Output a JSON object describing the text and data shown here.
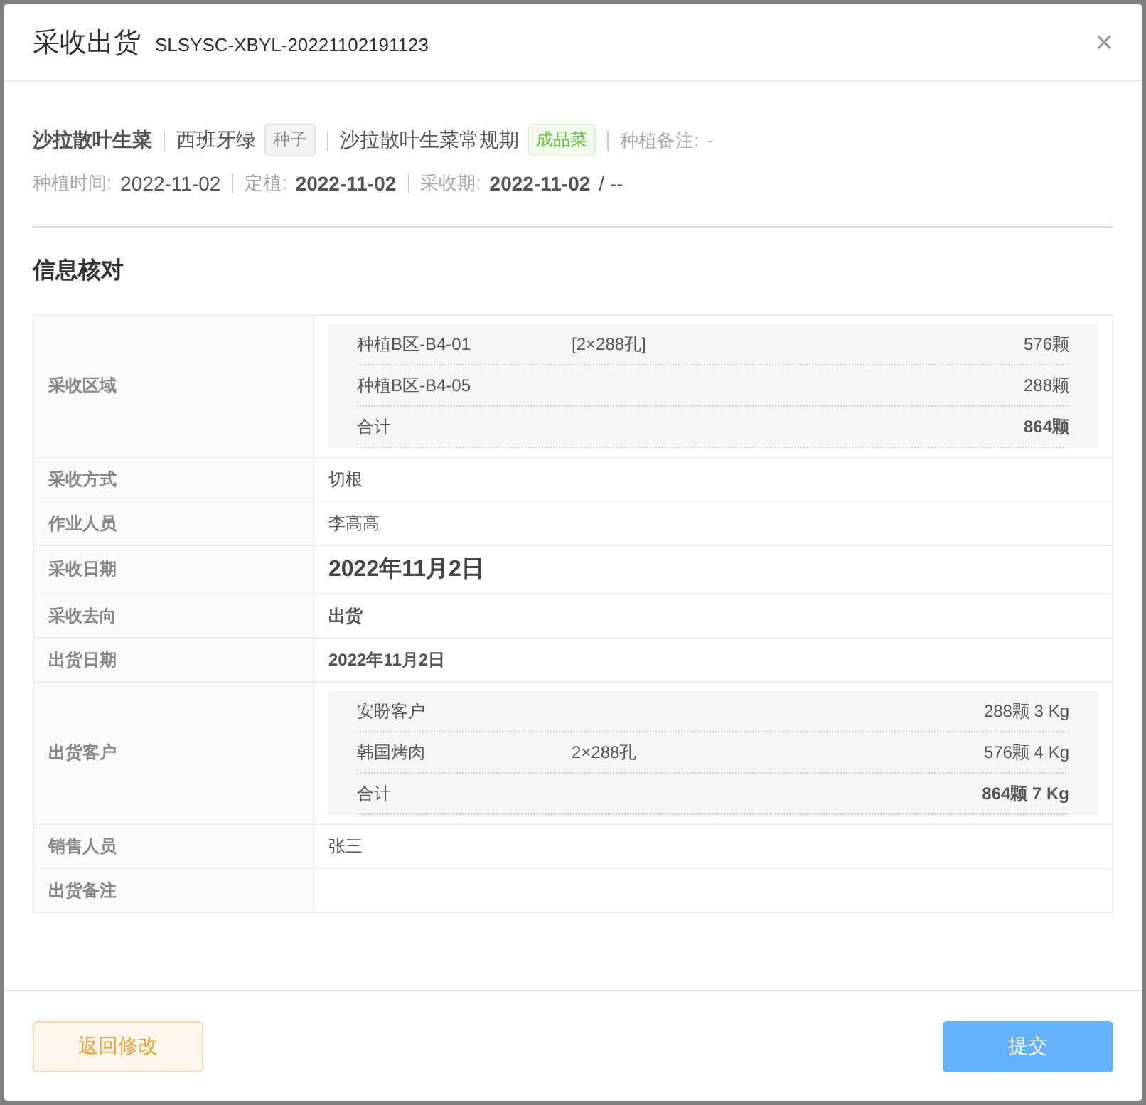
{
  "dialog": {
    "title": "采收出货",
    "code": "SLSYSC-XBYL-20221102191123",
    "close": "×"
  },
  "summary": {
    "crop": "沙拉散叶生菜",
    "variety": "西班牙绿",
    "variety_tag": "种子",
    "plan": "沙拉散叶生菜常规期",
    "plan_tag": "成品菜",
    "note_label": "种植备注:",
    "note_value": "-"
  },
  "dates": [
    {
      "label": "种植时间:",
      "value": "2022-11-02",
      "bold": false
    },
    {
      "label": "定植:",
      "value": "2022-11-02",
      "bold": true
    },
    {
      "label": "采收期:",
      "value": "2022-11-02",
      "bold": true,
      "suffix": "/ --"
    }
  ],
  "section_title": "信息核对",
  "rows": [
    {
      "label": "采收区域",
      "kind": "list",
      "items": [
        {
          "name": "种植B区-B4-01",
          "spec": "[2×288孔]",
          "amount": "576颗"
        },
        {
          "name": "种植B区-B4-05",
          "amount": "288颗"
        }
      ],
      "total": {
        "name": "合计",
        "amount": "864颗"
      }
    },
    {
      "label": "采收方式",
      "kind": "plain",
      "value": "切根"
    },
    {
      "label": "作业人员",
      "kind": "plain",
      "value": "李高高"
    },
    {
      "label": "采收日期",
      "kind": "large",
      "value": "2022年11月2日"
    },
    {
      "label": "采收去向",
      "kind": "bold",
      "value": "出货"
    },
    {
      "label": "出货日期",
      "kind": "bold",
      "value": "2022年11月2日"
    },
    {
      "label": "出货客户",
      "kind": "list",
      "items": [
        {
          "name": "安盼客户",
          "amount": "288颗 3 Kg"
        },
        {
          "name": "韩国烤肉",
          "spec": "2×288孔",
          "amount": "576颗 4 Kg"
        }
      ],
      "total": {
        "name": "合计",
        "amount": "864颗 7 Kg"
      }
    },
    {
      "label": "销售人员",
      "kind": "plain",
      "value": "张三"
    },
    {
      "label": "出货备注",
      "kind": "plain"
    }
  ],
  "buttons": {
    "back": "返回修改",
    "submit": "提交"
  }
}
